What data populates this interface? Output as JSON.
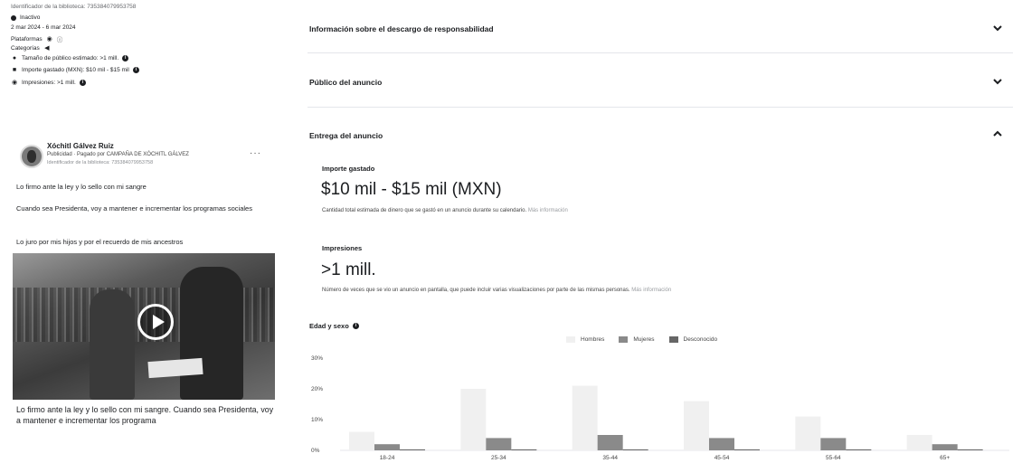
{
  "left": {
    "library_id": "Identificador de la biblioteca: 735384079953758",
    "status": "Inactivo",
    "dates": "2 mar 2024 - 6 mar 2024",
    "platforms_label": "Plataformas",
    "platforms_extra": "ⓘ",
    "categories_label": "Categorías",
    "audience_size": "Tamaño de público estimado: >1 mill.",
    "amount_spent": "Importe gastado (MXN): $10 mil - $15 mil",
    "impressions": "Impresiones: >1 mill.",
    "advertiser": {
      "name": "Xóchitl Gálvez Ruiz",
      "paid_by": "Publicidad · Pagado por CAMPAÑA DE XÓCHITL GÁLVEZ",
      "id_line": "Identificador de la biblioteca: 735384079953758",
      "more": "···"
    },
    "body": [
      "Lo firmo ante la ley y lo sello con mi sangre",
      "Cuando sea Presidenta, voy a mantener e incrementar los programas sociales",
      "Lo juro por mis hijos y por el recuerdo de mis ancestros"
    ],
    "caption": "Lo firmo ante la ley y lo sello con mi sangre. Cuando sea Presidenta, voy a mantener e incrementar los programa"
  },
  "sections": {
    "disclaimer": "Información sobre el descargo de responsabilidad",
    "audience": "Público del anuncio",
    "delivery": "Entrega del anuncio"
  },
  "delivery": {
    "spent_label": "Importe gastado",
    "spent_value": "$10 mil - $15 mil (MXN)",
    "spent_desc": "Cantidad total estimada de dinero que se gastó en un anuncio durante su calendario.",
    "more_info": "Más información",
    "impr_label": "Impresiones",
    "impr_value": ">1 mill.",
    "impr_desc": "Número de veces que se vio un anuncio en pantalla, que puede incluir varias visualizaciones por parte de las mismas personas."
  },
  "chart_data": {
    "type": "bar",
    "title": "Edad y sexo",
    "categories": [
      "18-24",
      "25-34",
      "35-44",
      "45-54",
      "55-64",
      "65+"
    ],
    "series": [
      {
        "name": "Hombres",
        "color": "#f0f0f0",
        "values": [
          6,
          20,
          21,
          16,
          11,
          5
        ]
      },
      {
        "name": "Mujeres",
        "color": "#8a8a8a",
        "values": [
          2,
          4,
          5,
          4,
          4,
          2
        ]
      },
      {
        "name": "Desconocido",
        "color": "#666666",
        "values": [
          0.3,
          0.3,
          0.3,
          0.3,
          0.3,
          0.3
        ]
      }
    ],
    "yticks": [
      "0%",
      "10%",
      "20%",
      "30%"
    ],
    "ylim": [
      0,
      30
    ]
  }
}
